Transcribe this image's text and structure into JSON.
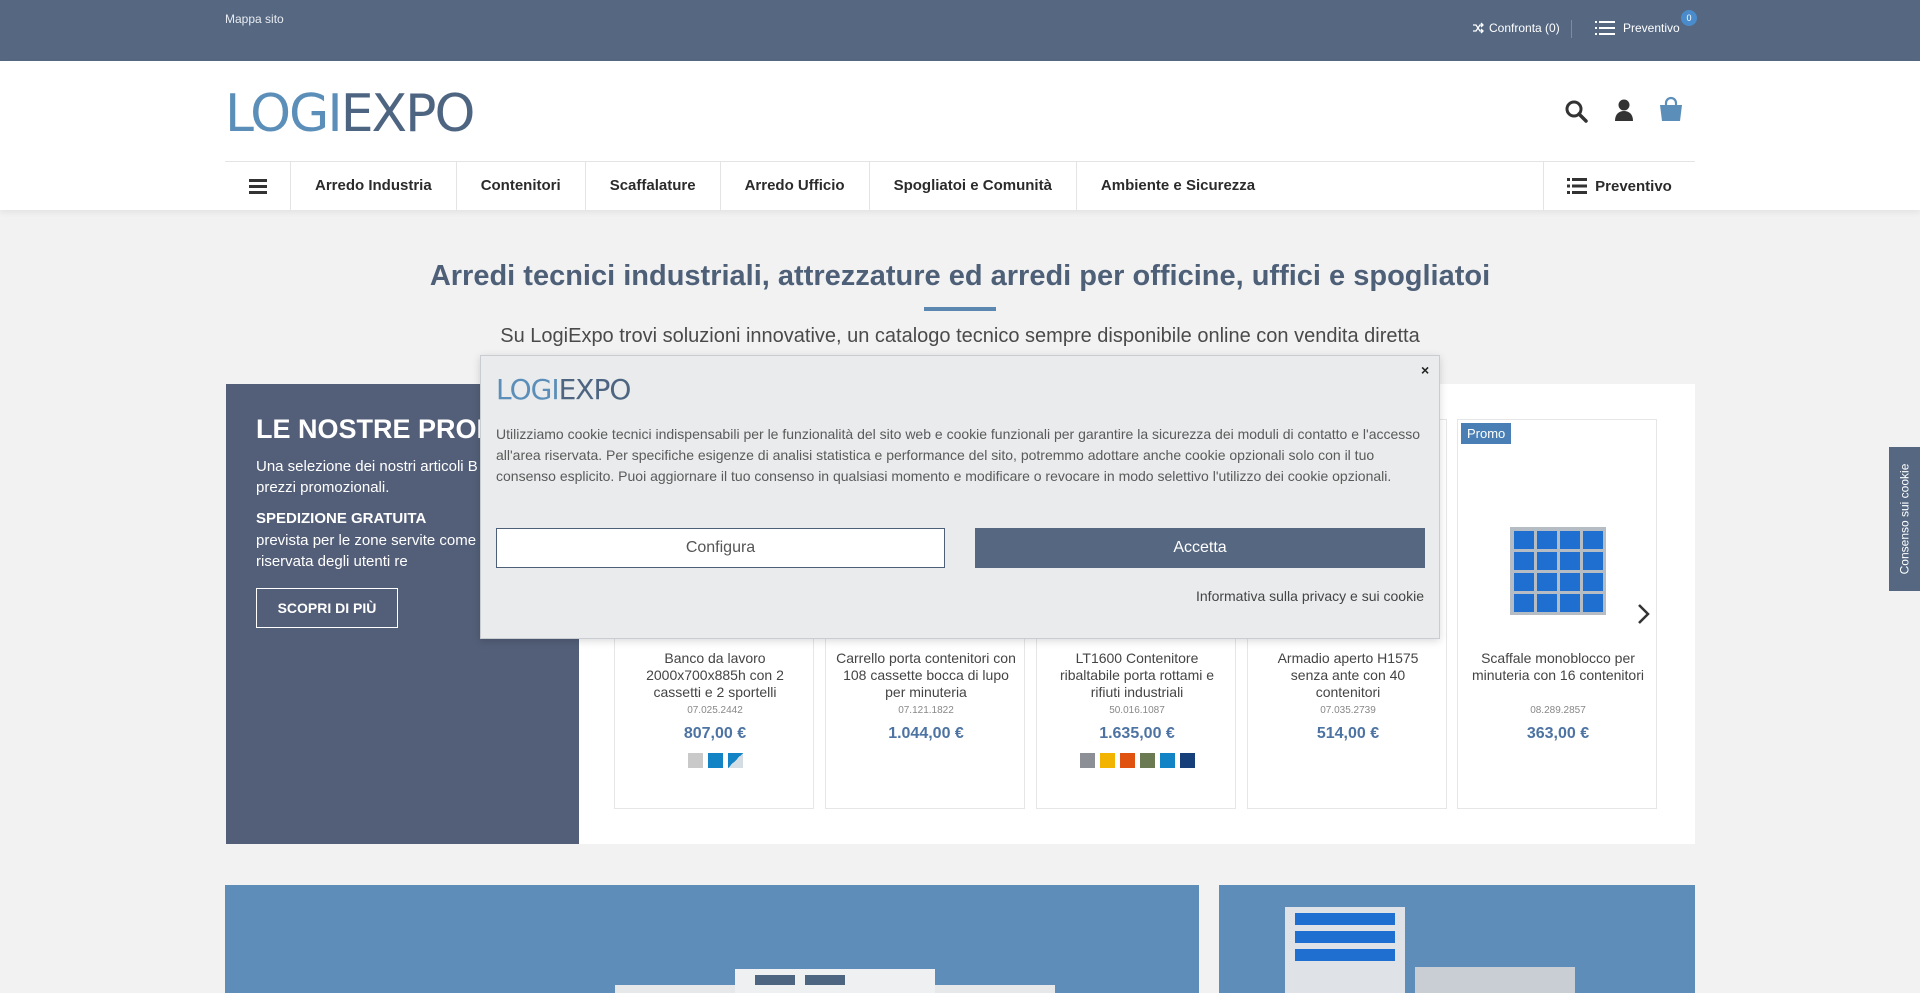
{
  "topbar": {
    "sitemap": "Mappa sito",
    "compare": "Confronta (0)",
    "quote": "Preventivo",
    "quote_count": "0"
  },
  "header": {
    "logo_part1": "LOGI",
    "logo_part2": "EXPO",
    "icons": [
      "search-icon",
      "user-icon",
      "shopping-bag-icon"
    ]
  },
  "nav": {
    "items": [
      "Arredo Industria",
      "Contenitori",
      "Scaffalature",
      "Arredo Ufficio",
      "Spogliatoi e Comunità",
      "Ambiente e Sicurezza"
    ],
    "quote_label": "Preventivo"
  },
  "hero": {
    "title": "Arredi tecnici industriali, attrezzature ed arredi per officine, uffici e spogliatoi",
    "subtitle": "Su LogiExpo trovi soluzioni innovative, un catalogo tecnico sempre disponibile online con vendita diretta"
  },
  "promo": {
    "title": "LE NOSTRE PROM",
    "text1": "Una selezione dei nostri articoli B  Seller con prezzi promozionali.",
    "shipping_title": "SPEDIZIONE GRATUITA",
    "shipping_text": "prevista per le zone servite come nell'area riservata degli utenti re",
    "button": "SCOPRI DI PIÙ"
  },
  "products": [
    {
      "name": "Banco da lavoro 2000x700x885h con 2 cassetti e 2 sportelli",
      "code": "07.025.2442",
      "price": "807,00 €",
      "swatches": [
        "#c9c9c9",
        "#1283c4",
        "#8fb9d9"
      ]
    },
    {
      "name": "Carrello porta contenitori con 108 cassette bocca di lupo per minuteria",
      "code": "07.121.1822",
      "price": "1.044,00 €",
      "swatches": []
    },
    {
      "name": "LT1600 Contenitore ribaltabile porta rottami e rifiuti industriali",
      "code": "50.016.1087",
      "price": "1.635,00 €",
      "swatches": [
        "#8c9096",
        "#f2b400",
        "#e0520f",
        "#6b7a52",
        "#1283c4",
        "#173f7a"
      ]
    },
    {
      "name": "Armadio aperto H1575 senza ante con 40 contenitori",
      "code": "07.035.2739",
      "price": "514,00 €",
      "swatches": []
    },
    {
      "name": "Scaffale monoblocco per minuteria con 16 contenitori",
      "code": "08.289.2857",
      "price": "363,00 €",
      "swatches": [],
      "badge": "Promo"
    }
  ],
  "cookie": {
    "logo_part1": "LOGI",
    "logo_part2": "EXPO",
    "text": "Utilizziamo cookie tecnici indispensabili per le funzionalità del sito web e cookie funzionali per garantire la sicurezza dei moduli di contatto e l'accesso all'area riservata. Per specifiche esigenze di analisi statistica e performance del sito, potremmo adottare anche cookie opzionali solo con il tuo consenso esplicito. Puoi aggiornare il tuo consenso in qualsiasi momento e modificare o revocare in modo selettivo l'utilizzo dei cookie opzionali.",
    "configure": "Configura",
    "accept": "Accetta",
    "privacy": "Informativa sulla privacy e sui cookie",
    "close": "×"
  },
  "side_tab": "Consenso sui cookie",
  "colors": {
    "topbar": "#556781",
    "accent": "#5b87b0",
    "price": "#4d73a3"
  }
}
